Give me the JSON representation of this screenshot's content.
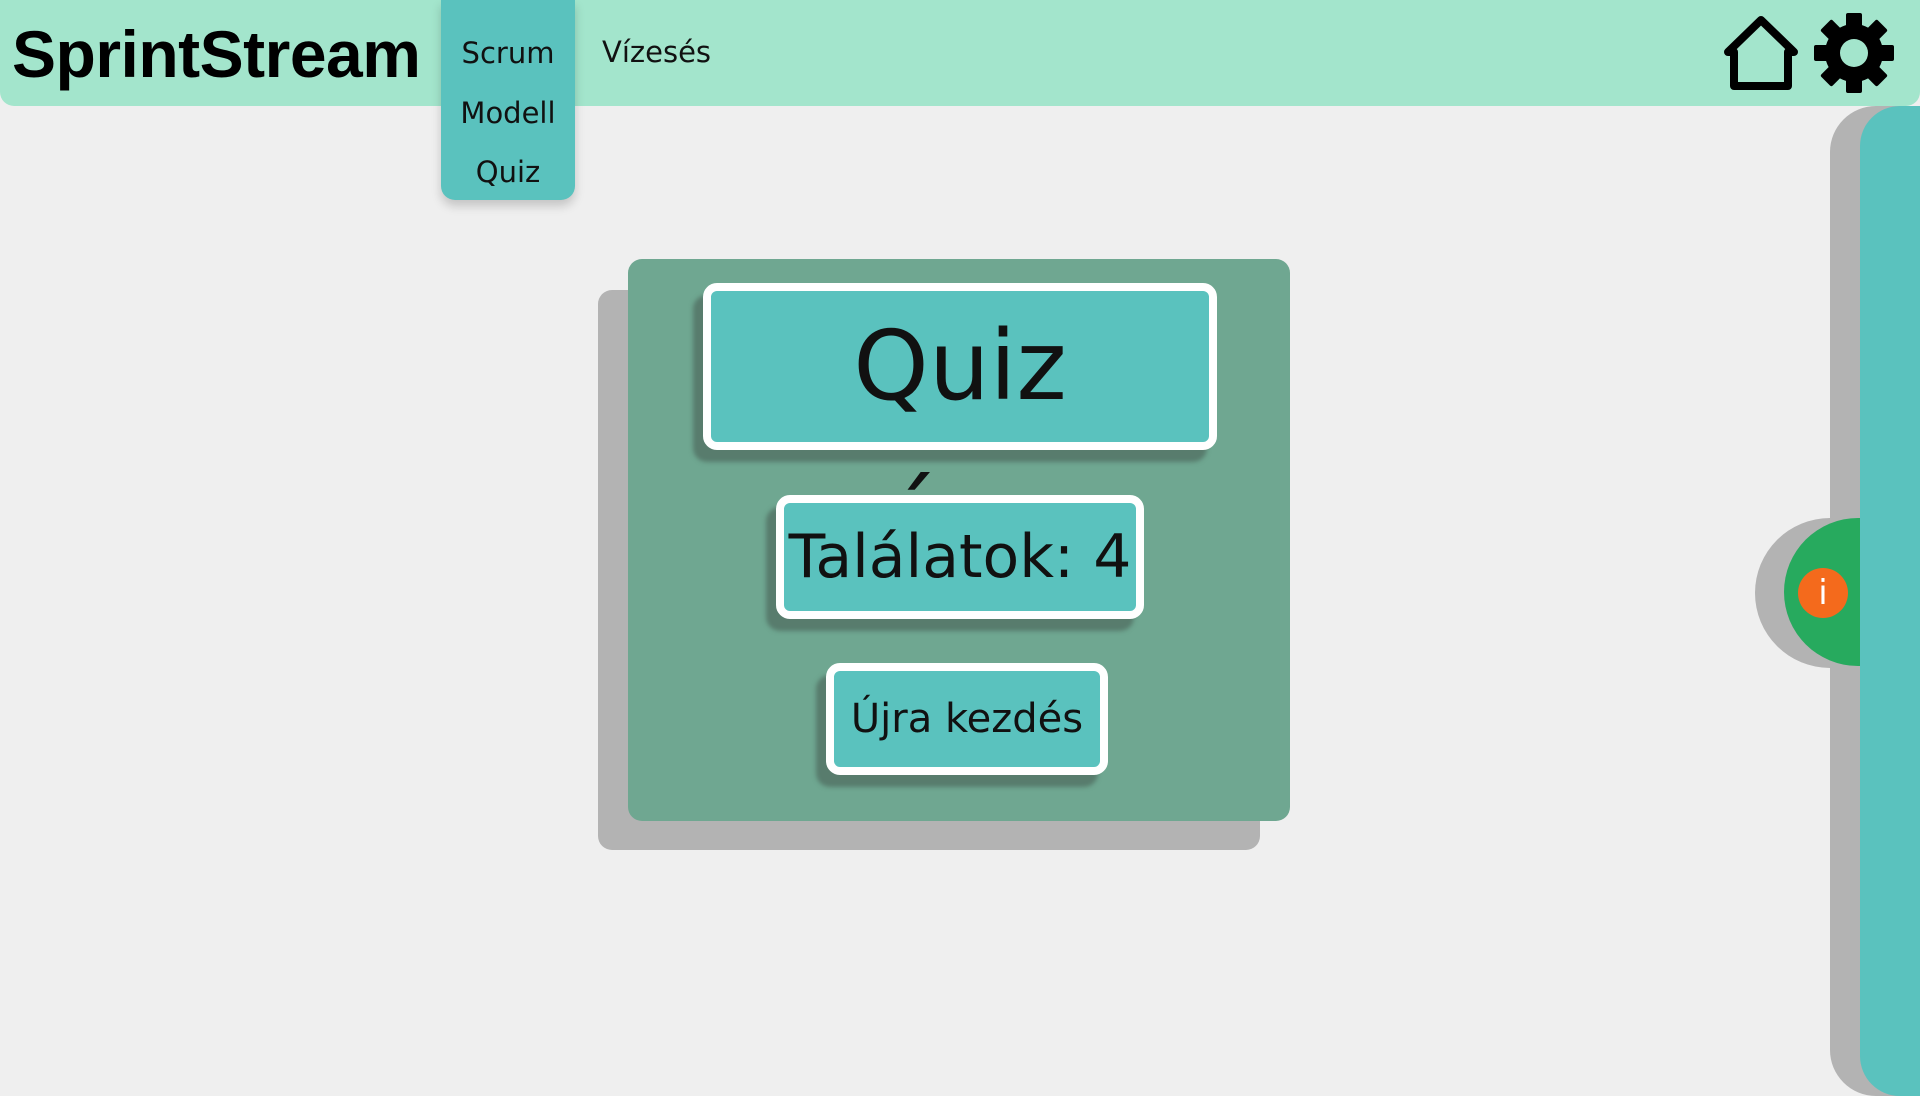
{
  "app": {
    "brand": "SprintStream"
  },
  "nav": {
    "scrum_menu": [
      "Scrum",
      "Modell",
      "Quiz"
    ],
    "vizeses": "Vízesés"
  },
  "icons": {
    "home": "home-icon",
    "settings": "gear-icon",
    "info": "info-icon"
  },
  "quiz": {
    "title": "Quiz vége.",
    "score_label": "Találatok: 4",
    "restart_label": "Újra kezdés"
  },
  "info": {
    "glyph": "i"
  },
  "colors": {
    "topbar": "#a3e5cc",
    "accent": "#5ac2be",
    "card": "#6fa791",
    "info_tab": "#27aa5e",
    "info_button": "#f46a1c"
  }
}
